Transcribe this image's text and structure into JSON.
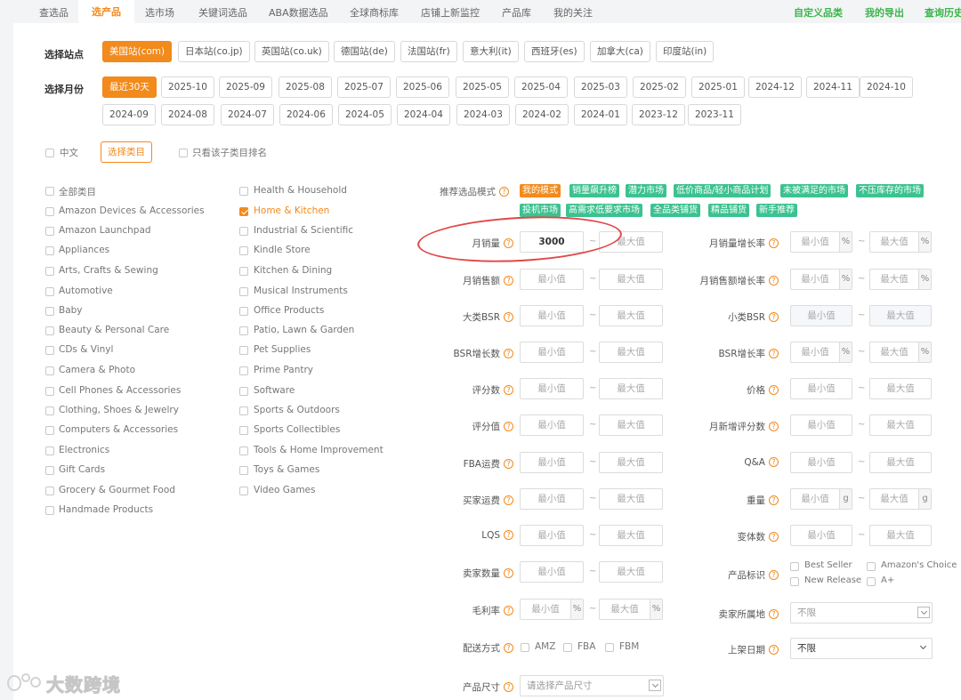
{
  "nav": {
    "tabs": [
      "查选品",
      "选产品",
      "选市场",
      "关键词选品",
      "ABA数据选品",
      "全球商标库",
      "店铺上新监控",
      "产品库",
      "我的关注"
    ],
    "right_links": [
      "自定义品类",
      "我的导出",
      "查询历史"
    ]
  },
  "site": {
    "label": "选择站点",
    "options": [
      "美国站(com)",
      "日本站(co.jp)",
      "英国站(co.uk)",
      "德国站(de)",
      "法国站(fr)",
      "意大利(it)",
      "西班牙(es)",
      "加拿大(ca)",
      "印度站(in)"
    ],
    "selected": "美国站(com)"
  },
  "month": {
    "label": "选择月份",
    "options": [
      "最近30天",
      "2025-10",
      "2025-09",
      "2025-08",
      "2025-07",
      "2025-06",
      "2025-05",
      "2025-04",
      "2025-03",
      "2025-02",
      "2025-01",
      "2024-12",
      "2024-11",
      "2024-10",
      "2024-09",
      "2024-08",
      "2024-07",
      "2024-06",
      "2024-05",
      "2024-04",
      "2024-03",
      "2024-02",
      "2024-01",
      "2023-12",
      "2023-11"
    ],
    "selected": "最近30天"
  },
  "category_options": {
    "chinese_label": "中文",
    "select_button": "选择类目",
    "sub_rank_label": "只看该子类目排名"
  },
  "categories": {
    "col1": [
      "全部类目",
      "Amazon Devices & Accessories",
      "Amazon Launchpad",
      "Appliances",
      "Arts, Crafts & Sewing",
      "Automotive",
      "Baby",
      "Beauty & Personal Care",
      "CDs & Vinyl",
      "Camera & Photo",
      "Cell Phones & Accessories",
      "Clothing, Shoes & Jewelry",
      "Computers & Accessories",
      "Electronics",
      "Gift Cards",
      "Grocery & Gourmet Food",
      "Handmade Products"
    ],
    "col2": [
      "Health & Household",
      "Home & Kitchen",
      "Industrial & Scientific",
      "Kindle Store",
      "Kitchen & Dining",
      "Musical Instruments",
      "Office Products",
      "Patio, Lawn & Garden",
      "Pet Supplies",
      "Prime Pantry",
      "Software",
      "Sports & Outdoors",
      "Sports Collectibles",
      "Tools & Home Improvement",
      "Toys & Games",
      "Video Games"
    ],
    "checked": "Home & Kitchen"
  },
  "modes": {
    "label": "推荐选品模式",
    "row1": [
      "我的模式",
      "销量飙升榜",
      "潜力市场",
      "低价商品/轻小商品计划",
      "未被满足的市场",
      "不压库存的市场"
    ],
    "row2": [
      "投机市场",
      "高需求低要求市场",
      "全品类铺货",
      "精品铺货",
      "新手推荐"
    ],
    "active": "我的模式"
  },
  "placeholders": {
    "min": "最小值",
    "max": "最大值",
    "tilde": "~",
    "pct": "%",
    "gram": "g"
  },
  "filters": {
    "monthly_sales": {
      "label": "月销量",
      "min_value": "3000"
    },
    "monthly_revenue": {
      "label": "月销售额"
    },
    "main_bsr": {
      "label": "大类BSR"
    },
    "bsr_growth_count": {
      "label": "BSR增长数"
    },
    "review_count": {
      "label": "评分数"
    },
    "rating": {
      "label": "评分值"
    },
    "fba_fee": {
      "label": "FBA运费"
    },
    "buyer_shipping": {
      "label": "买家运费"
    },
    "lqs": {
      "label": "LQS"
    },
    "seller_count": {
      "label": "卖家数量"
    },
    "gross_margin": {
      "label": "毛利率"
    },
    "fulfillment": {
      "label": "配送方式",
      "options": [
        "AMZ",
        "FBA",
        "FBM"
      ]
    },
    "product_size": {
      "label": "产品尺寸",
      "placeholder": "请选择产品尺寸"
    },
    "sales_growth": {
      "label": "月销量增长率"
    },
    "revenue_growth": {
      "label": "月销售额增长率"
    },
    "sub_bsr": {
      "label": "小类BSR"
    },
    "bsr_growth_rate": {
      "label": "BSR增长率"
    },
    "price": {
      "label": "价格"
    },
    "new_reviews": {
      "label": "月新增评分数"
    },
    "qa": {
      "label": "Q&A"
    },
    "weight": {
      "label": "重量"
    },
    "variants": {
      "label": "变体数"
    },
    "badges": {
      "label": "产品标识",
      "options": [
        "Best Seller",
        "Amazon's Choice",
        "New Release",
        "A+"
      ]
    },
    "seller_location": {
      "label": "卖家所属地",
      "value": "不限"
    },
    "listing_date": {
      "label": "上架日期",
      "value": "不限"
    }
  },
  "watermark": "大数跨境"
}
